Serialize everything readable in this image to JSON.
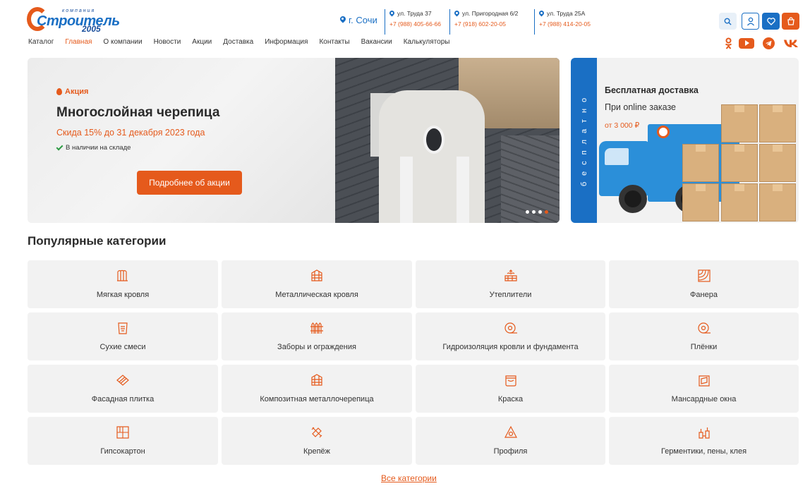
{
  "header": {
    "logo": {
      "small": "компания",
      "big": "Строитель",
      "year": "2005"
    },
    "city": "г. Сочи",
    "addresses": [
      {
        "street": "ул. Труда 37",
        "phone": "+7 (988) 405-66-66"
      },
      {
        "street": "ул. Пригородная 6/2",
        "phone": "+7 (918) 602-20-05"
      },
      {
        "street": "ул. Труда 25А",
        "phone": "+7 (988) 414-20-05"
      }
    ],
    "icons": [
      "search-icon",
      "user-icon",
      "heart-icon",
      "cart-icon"
    ]
  },
  "nav": {
    "items": [
      "Каталог",
      "Главная",
      "О компании",
      "Новости",
      "Акции",
      "Доставка",
      "Информация",
      "Контакты",
      "Вакансии",
      "Калькуляторы"
    ],
    "active": "Главная"
  },
  "social": {
    "icons": [
      "odnoklassniki-icon",
      "youtube-icon",
      "telegram-icon",
      "vk-icon"
    ]
  },
  "banner": {
    "tag": "Акция",
    "title": "Многослойная черепица",
    "subtitle": "Скида 15% до 31 декабря 2023 года",
    "stock": "В наличии на складе",
    "button": "Подробнее об акции",
    "slides_total": 4,
    "slide_active": 4
  },
  "delivery": {
    "vertical_text": "бесплатно",
    "title": "Бесплатная доставка",
    "subtitle": "При online заказе",
    "price": "от 3 000 ₽"
  },
  "categories": {
    "title": "Популярные категории",
    "items": [
      {
        "label": "Мягкая кровля",
        "icon": "soft-roof-icon"
      },
      {
        "label": "Металлическая кровля",
        "icon": "metal-roof-icon"
      },
      {
        "label": "Утеплители",
        "icon": "insulation-icon"
      },
      {
        "label": "Фанера",
        "icon": "plywood-icon"
      },
      {
        "label": "Сухие смеси",
        "icon": "dry-mix-icon"
      },
      {
        "label": "Заборы и ограждения",
        "icon": "fence-icon"
      },
      {
        "label": "Гидроизоляция кровли и фундамента",
        "icon": "waterproofing-icon"
      },
      {
        "label": "Плёнки",
        "icon": "film-roll-icon"
      },
      {
        "label": "Фасадная плитка",
        "icon": "facade-tile-icon"
      },
      {
        "label": "Композитная металлочерепица",
        "icon": "composite-tile-icon"
      },
      {
        "label": "Краска",
        "icon": "paint-icon"
      },
      {
        "label": "Мансардные окна",
        "icon": "roof-window-icon"
      },
      {
        "label": "Гипсокартон",
        "icon": "drywall-icon"
      },
      {
        "label": "Крепёж",
        "icon": "fastener-icon"
      },
      {
        "label": "Профиля",
        "icon": "profile-icon"
      },
      {
        "label": "Герментики, пены, клея",
        "icon": "sealant-icon"
      }
    ],
    "all_link": "Все категории"
  },
  "colors": {
    "accent": "#e55a1c",
    "brand": "#1a6fc4",
    "card": "#f2f2f2"
  }
}
